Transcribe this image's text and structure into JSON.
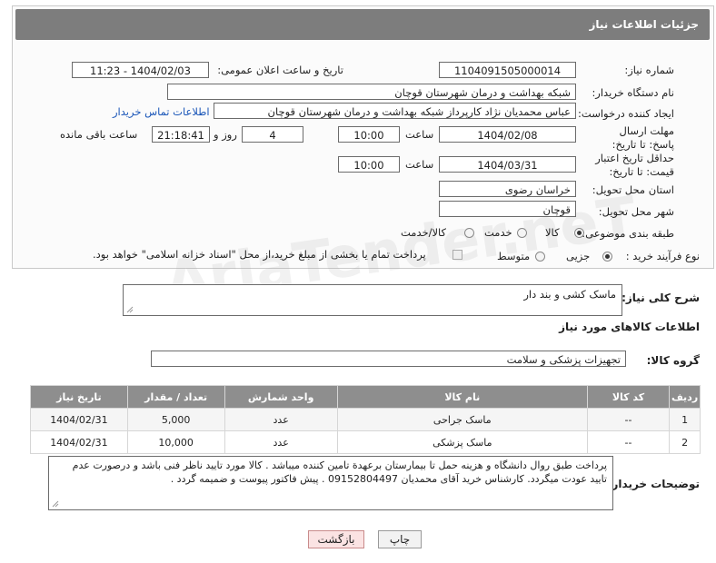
{
  "header": {
    "title": "جزئیات اطلاعات نیاز"
  },
  "fields": {
    "need_number_label": "شماره نیاز:",
    "need_number": "1104091505000014",
    "announce_label": "تاریخ و ساعت اعلان عمومی:",
    "announce_value": "1404/02/03 - 11:23",
    "buyer_org_label": "نام دستگاه خریدار:",
    "buyer_org": "شبکه بهداشت و درمان شهرستان قوچان",
    "requester_label": "ایجاد کننده درخواست:",
    "requester": "عباس محمدیان نژاد کارپرداز شبکه بهداشت و درمان شهرستان قوچان",
    "contact_link": "اطلاعات تماس خریدار",
    "reply_deadline_label": "مهلت ارسال پاسخ: تا تاریخ:",
    "reply_date": "1404/02/08",
    "time_label": "ساعت",
    "reply_time": "10:00",
    "days_value": "4",
    "days_label": "روز و",
    "remaining_time": "21:18:41",
    "remaining_label": "ساعت باقی مانده",
    "price_validity_label": "حداقل تاریخ اعتبار قیمت: تا تاریخ:",
    "price_date": "1404/03/31",
    "price_time": "10:00",
    "province_label": "استان محل تحویل:",
    "province": "خراسان رضوی",
    "city_label": "شهر محل تحویل:",
    "city": "قوچان",
    "category_label": "طبقه بندی موضوعی:",
    "category_options": [
      "کالا",
      "خدمت",
      "کالا/خدمت"
    ],
    "purchase_type_label": "نوع فرآیند خرید :",
    "purchase_options": [
      "جزیی",
      "متوسط"
    ],
    "payment_note": "پرداخت تمام یا بخشی از مبلغ خرید،از محل \"اسناد خزانه اسلامی\" خواهد بود."
  },
  "description": {
    "label": "شرح کلی نیاز:",
    "value": "ماسک کشی و بند دار"
  },
  "goods_info": {
    "title": "اطلاعات کالاهای مورد نیاز",
    "group_label": "گروه کالا:",
    "group_value": "تجهیزات پزشکی و سلامت"
  },
  "table": {
    "headers": [
      "ردیف",
      "کد کالا",
      "نام کالا",
      "واحد شمارش",
      "تعداد / مقدار",
      "تاریخ نیاز"
    ],
    "rows": [
      [
        "1",
        "--",
        "ماسک جراحی",
        "عدد",
        "5,000",
        "1404/02/31"
      ],
      [
        "2",
        "--",
        "ماسک پزشکی",
        "عدد",
        "10,000",
        "1404/02/31"
      ]
    ]
  },
  "buyer_notes": {
    "label": "توضیحات خریدار:",
    "value": "پرداخت طبق روال دانشگاه و هزینه حمل تا بیمارستان برعهدة تامین کننده میباشد . کالا مورد تایید ناظر فنی باشد و درصورت عدم تایید عودت میگردد. کارشناس خرید آقای محمدیان 09152804497 . پیش فاکتور پیوست و ضمیمه گردد ."
  },
  "buttons": {
    "print": "چاپ",
    "back": "بازگشت"
  },
  "watermark": "AriaTender.neT",
  "colors": {
    "header_bg": "#7d7d7d",
    "link": "#1a56b8",
    "back_bg": "#fbe3e3",
    "table_header": "#8e8e8e"
  }
}
